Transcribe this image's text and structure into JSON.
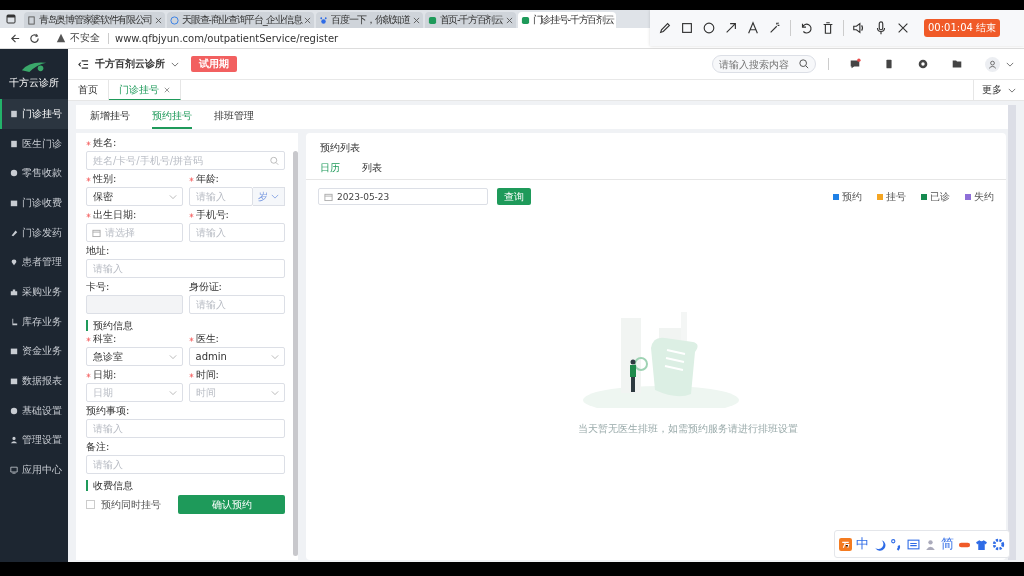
{
  "browser": {
    "tabs": [
      {
        "title": "青岛奥博管家婆软件有限公司",
        "kind": "doc",
        "selected": false
      },
      {
        "title": "天眼查-商业查询平台_企业信息",
        "kind": "globe",
        "selected": false
      },
      {
        "title": "百度一下，你就知道",
        "kind": "paw",
        "selected": false
      },
      {
        "title": "首页-千方百剂云",
        "kind": "leaf",
        "selected": false
      },
      {
        "title": "门诊挂号-千方百剂云",
        "kind": "leaf",
        "selected": true
      }
    ],
    "security_label": "不安全",
    "url": "www.qfbjyun.com/outpatientService/register"
  },
  "recorder": {
    "timer": "00:01:04 结束"
  },
  "app": {
    "logo_caption": "千方云诊所",
    "clinic": "千方百剂云诊所",
    "badge": "试用期",
    "search": {
      "placeholder": "请输入搜索内容"
    },
    "messages_unread": true
  },
  "sidebar": [
    {
      "label": "门诊挂号",
      "kind": "register",
      "selected": true
    },
    {
      "label": "医生门诊",
      "kind": "doctor",
      "selected": false
    },
    {
      "label": "零售收款",
      "kind": "coin",
      "selected": false
    },
    {
      "label": "门诊收费",
      "kind": "copy",
      "selected": false
    },
    {
      "label": "门诊发药",
      "kind": "pill",
      "selected": false
    },
    {
      "label": "患者管理",
      "kind": "pin",
      "selected": false
    },
    {
      "label": "采购业务",
      "kind": "bag",
      "selected": false
    },
    {
      "label": "库存业务",
      "kind": "cart",
      "selected": false
    },
    {
      "label": "资金业务",
      "kind": "copy",
      "selected": false
    },
    {
      "label": "数据报表",
      "kind": "chart",
      "selected": false
    },
    {
      "label": "基础设置",
      "kind": "gear",
      "selected": false
    },
    {
      "label": "管理设置",
      "kind": "person",
      "selected": false
    },
    {
      "label": "应用中心",
      "kind": "monitor",
      "selected": false
    }
  ],
  "page_tabs": [
    {
      "label": "首页",
      "selected": false,
      "closable": false
    },
    {
      "label": "门诊挂号",
      "selected": true,
      "closable": true
    }
  ],
  "more": "更多",
  "subtabs": [
    {
      "label": "新增挂号",
      "selected": false
    },
    {
      "label": "预约挂号",
      "selected": true
    },
    {
      "label": "排班管理",
      "selected": false
    }
  ],
  "form": {
    "sections": [
      {
        "rows": [
          [
            {
              "label": "姓名:",
              "required": true,
              "kind": "search",
              "placeholder": "姓名/卡号/手机号/拼音码"
            }
          ],
          [
            {
              "label": "性别:",
              "required": true,
              "kind": "select",
              "value": "保密"
            },
            {
              "label": "年龄:",
              "required": true,
              "kind": "unit",
              "placeholder": "请输入",
              "unit": "岁"
            }
          ],
          [
            {
              "label": "出生日期:",
              "required": true,
              "kind": "date",
              "placeholder": "请选择"
            },
            {
              "label": "手机号:",
              "required": true,
              "kind": "input",
              "placeholder": "请输入"
            }
          ],
          [
            {
              "label": "地址:",
              "required": false,
              "kind": "input",
              "placeholder": "请输入"
            }
          ],
          [
            {
              "label": "卡号:",
              "required": false,
              "kind": "disabled"
            },
            {
              "label": "身份证:",
              "required": false,
              "kind": "input",
              "placeholder": "请输入"
            }
          ]
        ]
      },
      {
        "title": "预约信息",
        "rows": [
          [
            {
              "label": "科室:",
              "required": true,
              "kind": "select",
              "value": "急诊室"
            },
            {
              "label": "医生:",
              "required": true,
              "kind": "select",
              "value": "admin"
            }
          ],
          [
            {
              "label": "日期:",
              "required": true,
              "kind": "select",
              "placeholder": "日期"
            },
            {
              "label": "时间:",
              "required": true,
              "kind": "select",
              "placeholder": "时间"
            }
          ],
          [
            {
              "label": "预约事项:",
              "required": false,
              "kind": "input",
              "placeholder": "请输入"
            }
          ],
          [
            {
              "label": "备注:",
              "required": false,
              "kind": "input",
              "placeholder": "请输入"
            }
          ]
        ]
      }
    ],
    "fee": {
      "title": "收费信息",
      "checkbox": {
        "label": "预约同时挂号",
        "checked": false
      },
      "submit": "确认预约"
    }
  },
  "list": {
    "title": "预约列表",
    "tabs": [
      {
        "label": "日历",
        "selected": true
      },
      {
        "label": "列表",
        "selected": false
      }
    ],
    "date": "2023-05-23",
    "query": "查询",
    "legend": [
      {
        "label": "预约",
        "color": "#1e80e6"
      },
      {
        "label": "挂号",
        "color": "#f5a623"
      },
      {
        "label": "已诊",
        "color": "#168a4f"
      },
      {
        "label": "失约",
        "color": "#8e6fd8"
      }
    ],
    "empty_text": "当天暂无医生排班，如需预约服务请进行排班设置"
  },
  "ime": {
    "mode": "中",
    "script": "简"
  }
}
